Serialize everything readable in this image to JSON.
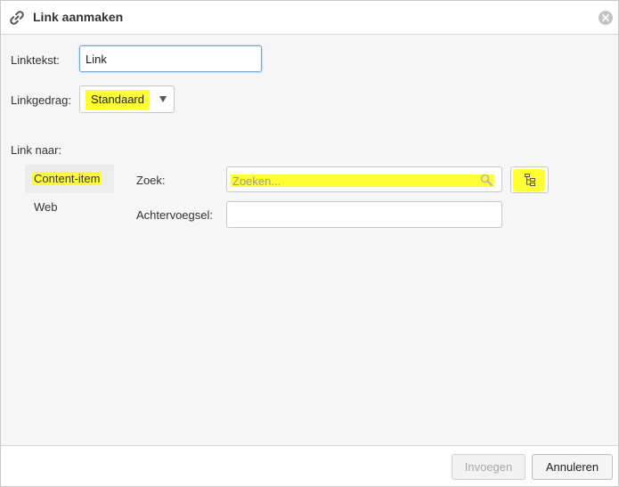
{
  "dialog": {
    "title": "Link aanmaken",
    "icons": {
      "title": "link-icon",
      "close": "close-icon"
    }
  },
  "form": {
    "link_text_label": "Linktekst:",
    "link_text_value": "Link",
    "behavior_label": "Linkgedrag:",
    "behavior_value": "Standaard",
    "link_to_label": "Link naar:"
  },
  "tabs": [
    {
      "label": "Content-item",
      "active": true
    },
    {
      "label": "Web",
      "active": false
    }
  ],
  "content_item": {
    "search_label": "Zoek:",
    "search_placeholder": "Zoeken...",
    "search_value": "",
    "suffix_label": "Achtervoegsel:",
    "suffix_value": "",
    "icons": {
      "search": "search-icon",
      "browse": "tree-icon"
    }
  },
  "footer": {
    "insert_label": "Invoegen",
    "insert_disabled": true,
    "cancel_label": "Annuleren"
  },
  "colors": {
    "highlight": "#ffff33",
    "focus_border": "#6ca7d8",
    "panel_bg": "#f6f6f6"
  }
}
